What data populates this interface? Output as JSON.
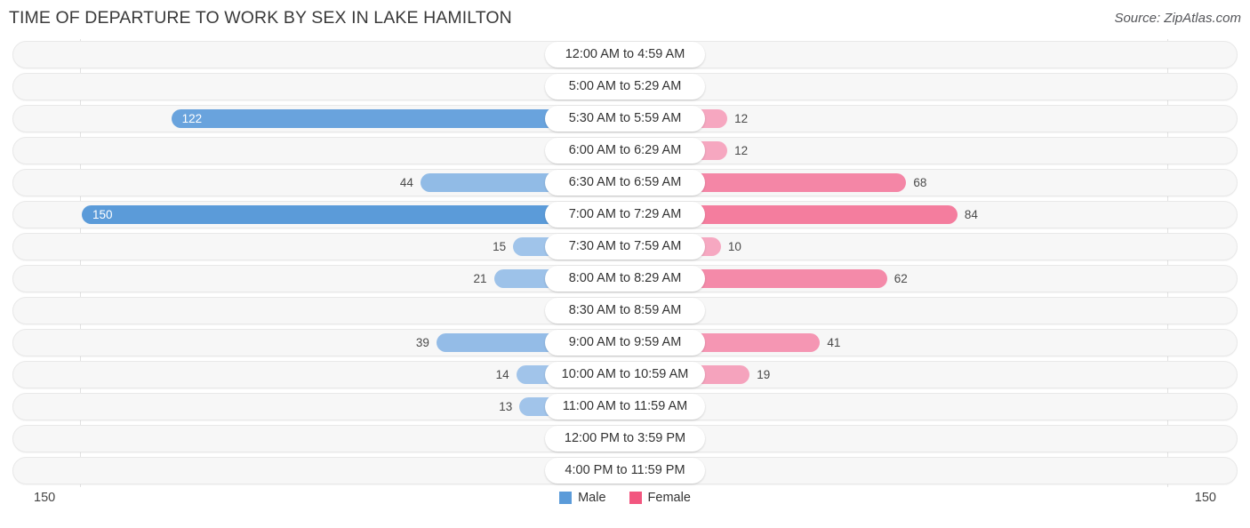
{
  "header": {
    "title": "TIME OF DEPARTURE TO WORK BY SEX IN LAKE HAMILTON",
    "source": "Source: ZipAtlas.com"
  },
  "legend": {
    "male_label": "Male",
    "female_label": "Female",
    "male_color": "#5b9bd9",
    "female_color": "#f2567f"
  },
  "axis": {
    "left_max": "150",
    "right_max": "150"
  },
  "chart_data": {
    "type": "bar",
    "title": "TIME OF DEPARTURE TO WORK BY SEX IN LAKE HAMILTON",
    "subtitle": "Source: ZipAtlas.com",
    "orientation": "horizontal-diverging",
    "xlabel": "",
    "ylabel": "",
    "xlim": [
      150,
      150
    ],
    "grid": false,
    "legend_position": "bottom-center",
    "categories": [
      "12:00 AM to 4:59 AM",
      "5:00 AM to 5:29 AM",
      "5:30 AM to 5:59 AM",
      "6:00 AM to 6:29 AM",
      "6:30 AM to 6:59 AM",
      "7:00 AM to 7:29 AM",
      "7:30 AM to 7:59 AM",
      "8:00 AM to 8:29 AM",
      "8:30 AM to 8:59 AM",
      "9:00 AM to 9:59 AM",
      "10:00 AM to 10:59 AM",
      "11:00 AM to 11:59 AM",
      "12:00 PM to 3:59 PM",
      "4:00 PM to 11:59 PM"
    ],
    "series": [
      {
        "name": "Male",
        "color": "#5b9bd9",
        "values": [
          0,
          0,
          122,
          0,
          44,
          150,
          15,
          21,
          0,
          39,
          14,
          13,
          0,
          0
        ]
      },
      {
        "name": "Female",
        "color": "#f2567f",
        "values": [
          0,
          0,
          12,
          12,
          68,
          84,
          10,
          62,
          0,
          41,
          19,
          0,
          0,
          0
        ]
      }
    ]
  },
  "rows": [
    {
      "category": "12:00 AM to 4:59 AM",
      "male": "0",
      "female": "0"
    },
    {
      "category": "5:00 AM to 5:29 AM",
      "male": "0",
      "female": "0"
    },
    {
      "category": "5:30 AM to 5:59 AM",
      "male": "122",
      "female": "12"
    },
    {
      "category": "6:00 AM to 6:29 AM",
      "male": "0",
      "female": "12"
    },
    {
      "category": "6:30 AM to 6:59 AM",
      "male": "44",
      "female": "68"
    },
    {
      "category": "7:00 AM to 7:29 AM",
      "male": "150",
      "female": "84"
    },
    {
      "category": "7:30 AM to 7:59 AM",
      "male": "15",
      "female": "10"
    },
    {
      "category": "8:00 AM to 8:29 AM",
      "male": "21",
      "female": "62"
    },
    {
      "category": "8:30 AM to 8:59 AM",
      "male": "0",
      "female": "0"
    },
    {
      "category": "9:00 AM to 9:59 AM",
      "male": "39",
      "female": "41"
    },
    {
      "category": "10:00 AM to 10:59 AM",
      "male": "14",
      "female": "19"
    },
    {
      "category": "11:00 AM to 11:59 AM",
      "male": "13",
      "female": "0"
    },
    {
      "category": "12:00 PM to 3:59 PM",
      "male": "0",
      "female": "0"
    },
    {
      "category": "4:00 PM to 11:59 PM",
      "male": "0",
      "female": "0"
    }
  ]
}
